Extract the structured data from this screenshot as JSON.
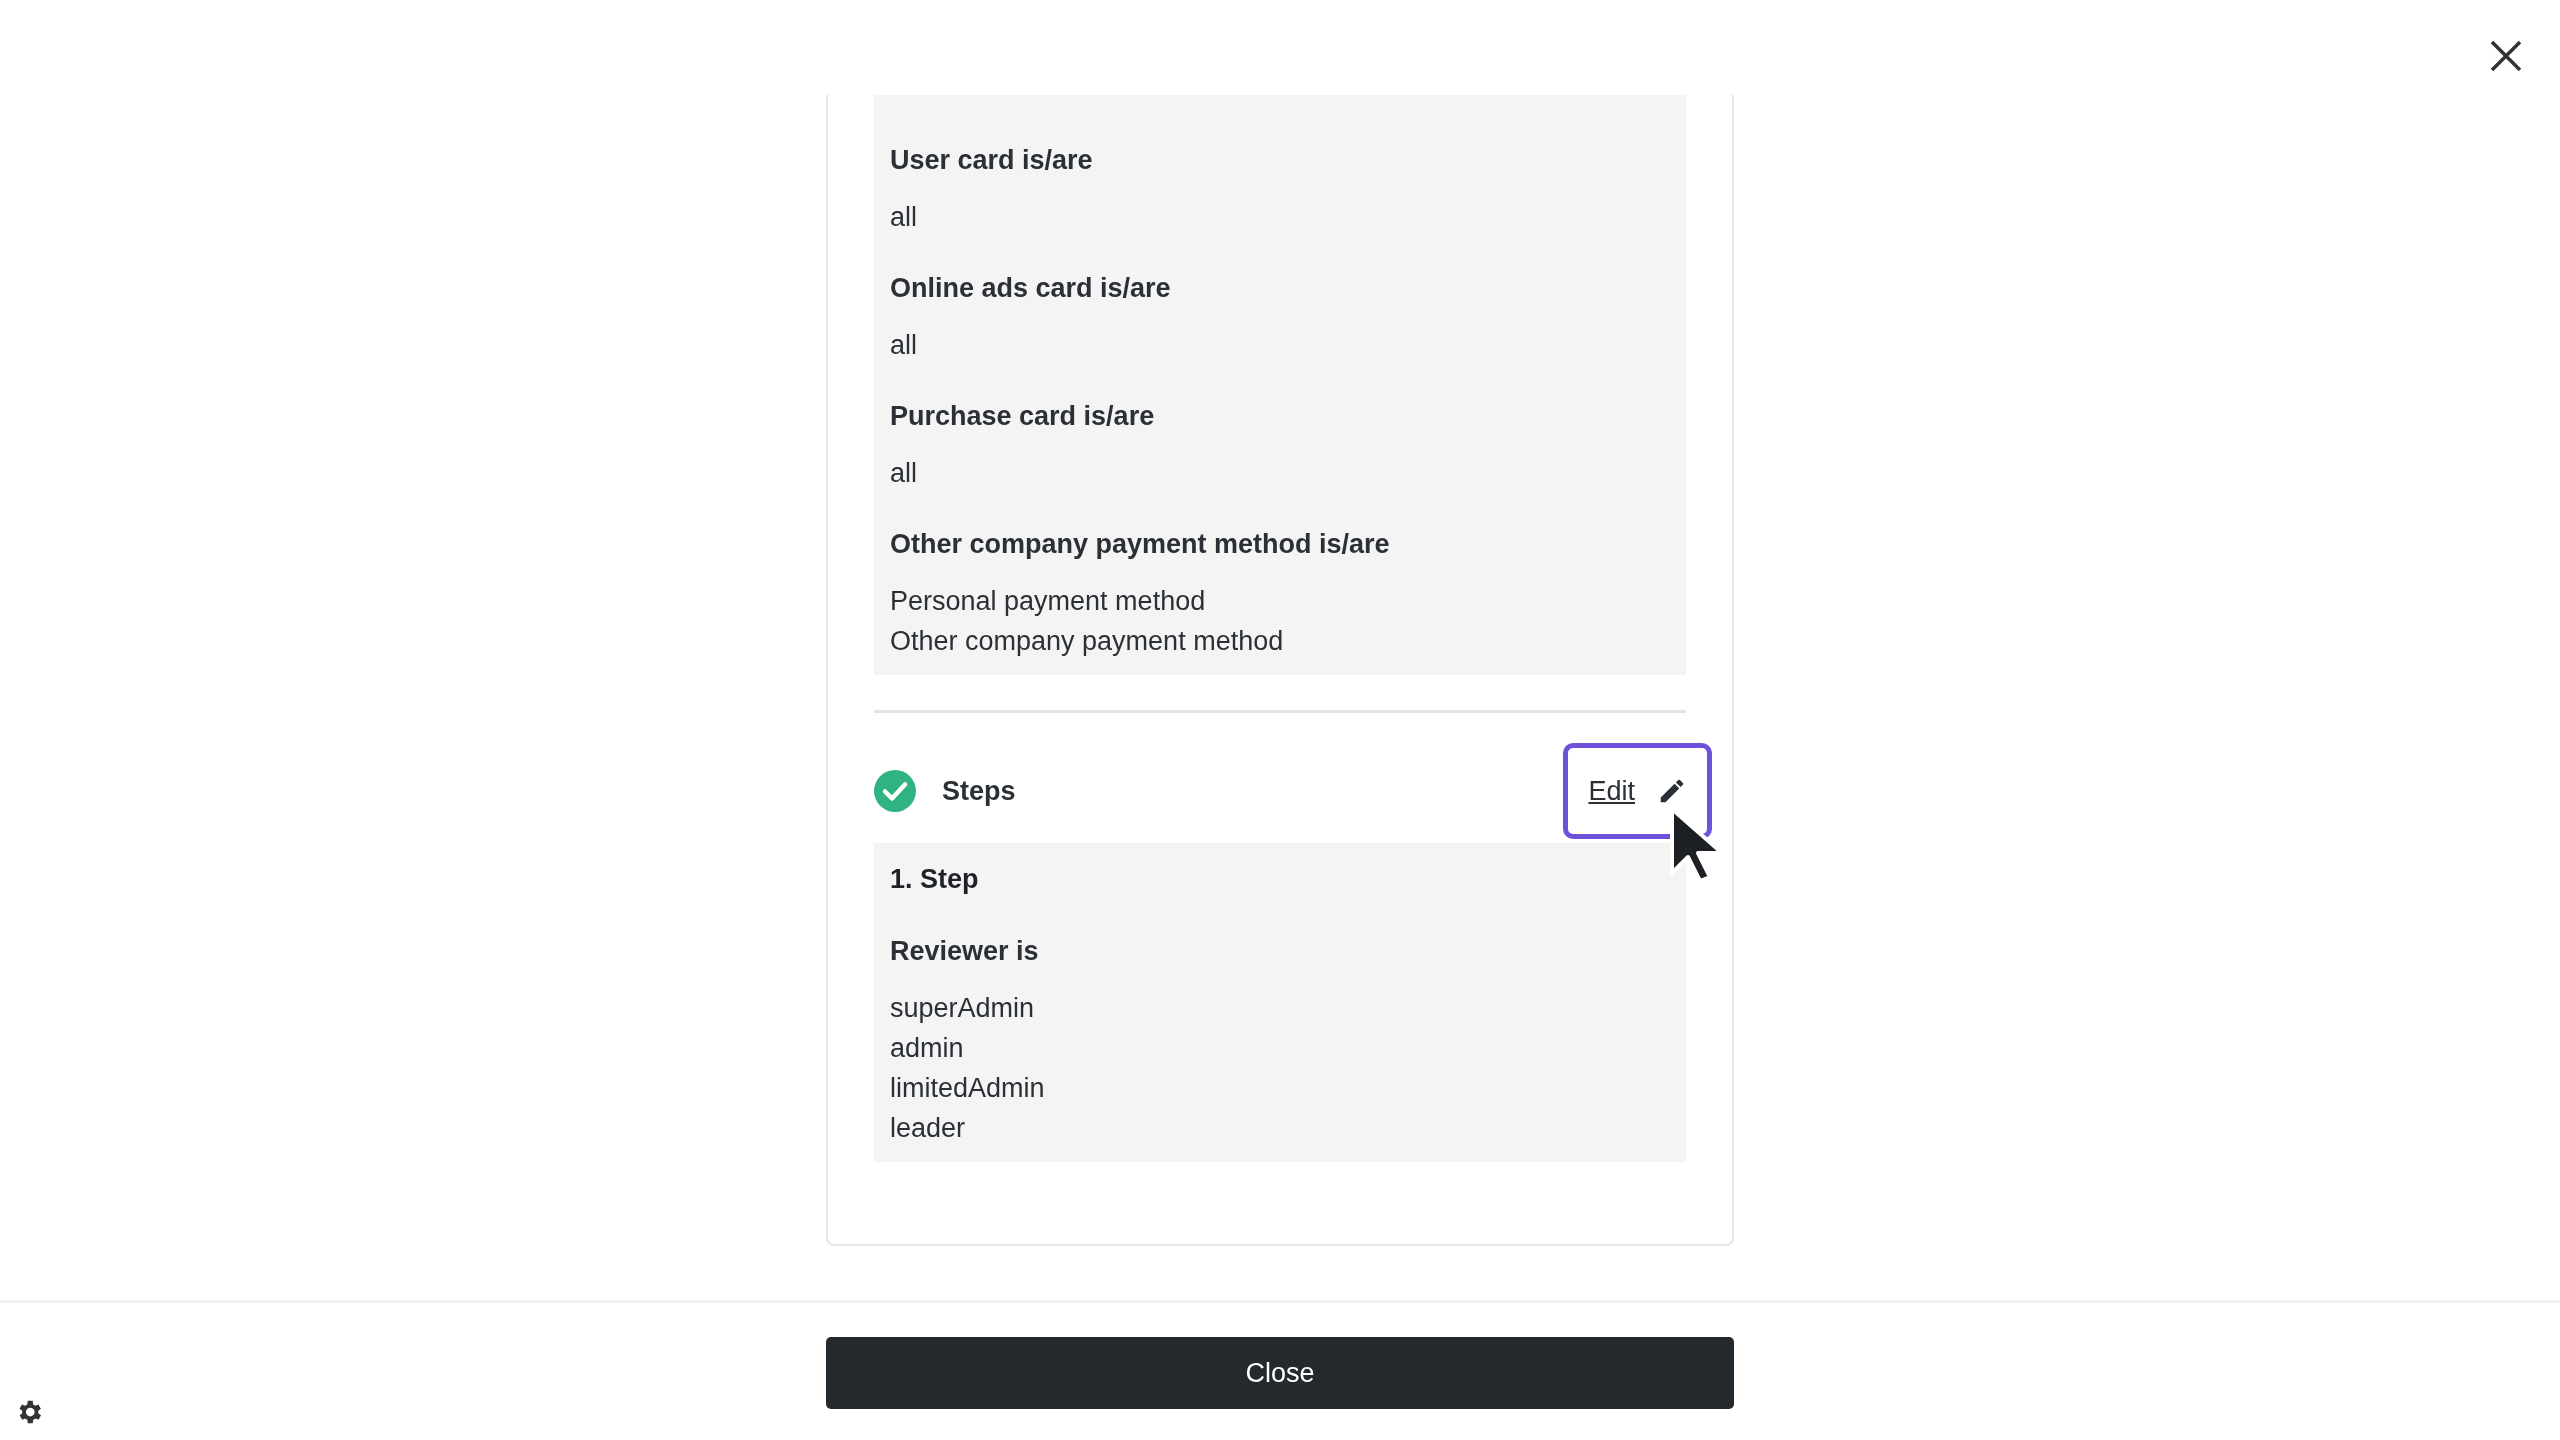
{
  "conditions": [
    {
      "label": "User card is/are",
      "values": [
        "all"
      ]
    },
    {
      "label": "Online ads card is/are",
      "values": [
        "all"
      ]
    },
    {
      "label": "Purchase card is/are",
      "values": [
        "all"
      ]
    },
    {
      "label": "Other company payment method is/are",
      "values": [
        "Personal payment method",
        "Other company payment method"
      ]
    }
  ],
  "steps_section": {
    "title": "Steps",
    "complete": true,
    "edit_label": "Edit",
    "edit_focused": true,
    "steps": [
      {
        "title": "1. Step",
        "reviewer_label": "Reviewer is",
        "reviewers": [
          "superAdmin",
          "admin",
          "limitedAdmin",
          "leader"
        ]
      }
    ]
  },
  "footer": {
    "close_label": "Close"
  }
}
